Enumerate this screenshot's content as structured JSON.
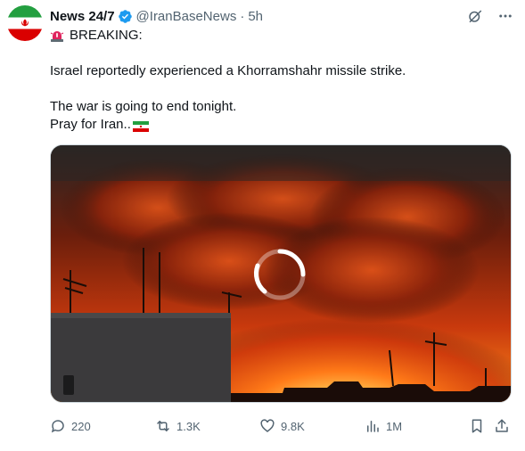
{
  "tweet": {
    "display_name": "News 24/7",
    "handle": "@IranBaseNews",
    "separator": "·",
    "time": "5h",
    "lines": {
      "breaking": "BREAKING:",
      "line1": "Israel reportedly experienced a Khorramshahr missile strike.",
      "line2": "The war is going to end tonight.",
      "line3": "Pray for Iran.."
    },
    "icons": {
      "avatar": "iran-flag-avatar",
      "verified": "verified-badge-icon",
      "grok": "grok-icon",
      "more": "more-icon",
      "siren": "police-siren-emoji",
      "flag": "iran-flag-emoji"
    }
  },
  "media": {
    "type": "video",
    "state": "loading",
    "icons": {
      "spinner": "loading-spinner-icon"
    }
  },
  "actions": {
    "replies": "220",
    "reposts": "1.3K",
    "likes": "9.8K",
    "views": "1M",
    "icons": [
      "reply-icon",
      "repost-icon",
      "like-icon",
      "views-icon",
      "bookmark-icon",
      "share-icon"
    ]
  },
  "colors": {
    "text": "#0f1419",
    "secondary": "#536471",
    "verified": "#1d9bf0",
    "flag_green": "#239f40",
    "flag_red": "#da0000"
  }
}
